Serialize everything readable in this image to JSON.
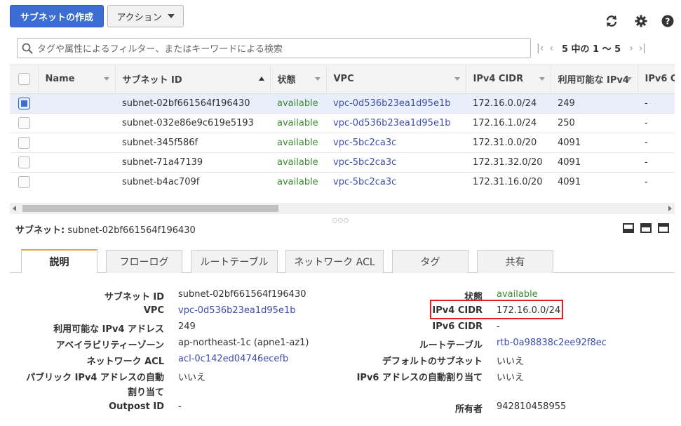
{
  "toolbar": {
    "create_label": "サブネットの作成",
    "actions_label": "アクション",
    "icons": [
      "refresh-icon",
      "gear-icon",
      "help-icon"
    ]
  },
  "search": {
    "placeholder": "タグや属性によるフィルター、またはキーワードによる検索"
  },
  "pager": {
    "text": "5 中の 1 ～ 5"
  },
  "table": {
    "columns": [
      "Name",
      "サブネット ID",
      "状態",
      "VPC",
      "IPv4 CIDR",
      "利用可能な IPv4",
      "IPv6 C"
    ],
    "rows": [
      {
        "name": "",
        "subnet_id": "subnet-02bf661564f196430",
        "state": "available",
        "vpc": "vpc-0d536b23ea1d95e1b",
        "cidr": "172.16.0.0/24",
        "available_ips": "249",
        "ipv6": "-",
        "selected": true
      },
      {
        "name": "",
        "subnet_id": "subnet-032e86e9c619e5193",
        "state": "available",
        "vpc": "vpc-0d536b23ea1d95e1b",
        "cidr": "172.16.1.0/24",
        "available_ips": "250",
        "ipv6": "-",
        "selected": false
      },
      {
        "name": "",
        "subnet_id": "subnet-345f586f",
        "state": "available",
        "vpc": "vpc-5bc2ca3c",
        "cidr": "172.31.0.0/20",
        "available_ips": "4091",
        "ipv6": "-",
        "selected": false
      },
      {
        "name": "",
        "subnet_id": "subnet-71a47139",
        "state": "available",
        "vpc": "vpc-5bc2ca3c",
        "cidr": "172.31.32.0/20",
        "available_ips": "4091",
        "ipv6": "-",
        "selected": false
      },
      {
        "name": "",
        "subnet_id": "subnet-b4ac709f",
        "state": "available",
        "vpc": "vpc-5bc2ca3c",
        "cidr": "172.31.16.0/20",
        "available_ips": "4091",
        "ipv6": "-",
        "selected": false
      }
    ]
  },
  "details": {
    "title_label": "サブネット:",
    "title_value": "subnet-02bf661564f196430",
    "tabs": [
      "説明",
      "フローログ",
      "ルートテーブル",
      "ネットワーク ACL",
      "タグ",
      "共有"
    ],
    "active_tab": "説明",
    "left": [
      {
        "label": "サブネット ID",
        "value": "subnet-02bf661564f196430"
      },
      {
        "label": "VPC",
        "value": "vpc-0d536b23ea1d95e1b"
      },
      {
        "label": "利用可能な IPv4 アドレス",
        "value": "249"
      },
      {
        "label": "アベイラビリティーゾーン",
        "value": "ap-northeast-1c (apne1-az1)"
      },
      {
        "label": "ネットワーク ACL",
        "value": "acl-0c142ed04746ecefb"
      },
      {
        "label": "パブリック IPv4 アドレスの自動",
        "label2": "割り当て",
        "value": "いいえ"
      },
      {
        "label": "Outpost ID",
        "value": "-"
      }
    ],
    "right": [
      {
        "label": "状態",
        "value": "available"
      },
      {
        "label": "IPv4 CIDR",
        "value": "172.16.0.0/24"
      },
      {
        "label": "IPv6 CIDR",
        "value": "-"
      },
      {
        "label": "ルートテーブル",
        "value": "rtb-0a98838c2ee92f8ec"
      },
      {
        "label": "デフォルトのサブネット",
        "value": "いいえ"
      },
      {
        "label": "IPv6 アドレスの自動割り当て",
        "value": "いいえ"
      },
      {
        "label": "所有者",
        "value": "942810458955"
      }
    ]
  },
  "colors": {
    "primary": "#3b6ed0",
    "status_green": "#3a8a2e",
    "link_blue": "#3d4eab",
    "tab_accent": "#e9a23b",
    "highlight_red": "#e02020"
  }
}
